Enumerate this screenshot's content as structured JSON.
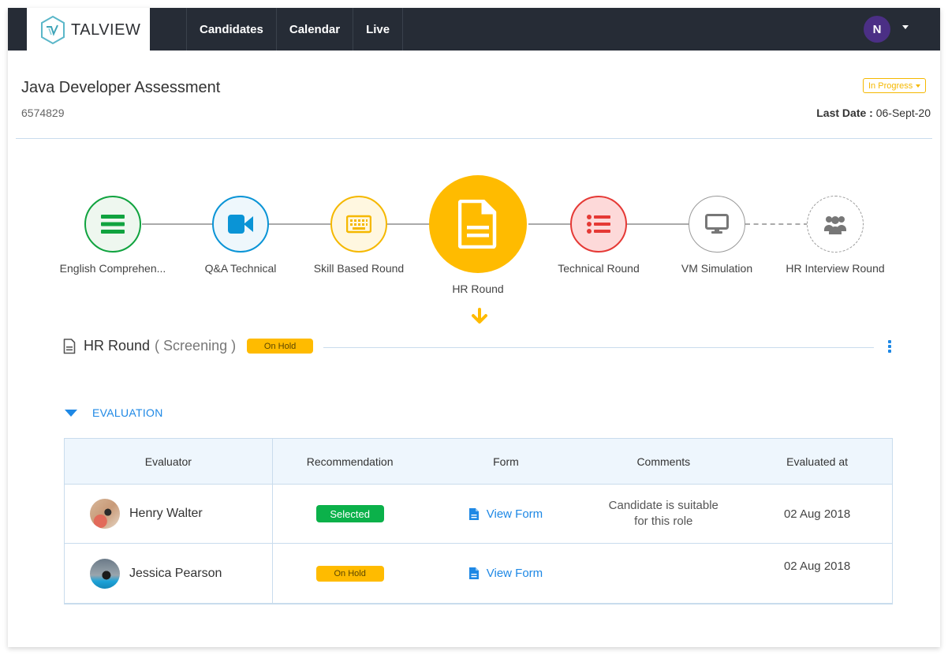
{
  "app": {
    "brand": "TALVIEW",
    "nav": [
      {
        "label": "Candidates"
      },
      {
        "label": "Calendar"
      },
      {
        "label": "Live"
      }
    ],
    "user_initial": "N",
    "colors": {
      "topbar": "#262c36",
      "accent": "#1e88e5",
      "warning": "#ffbb00",
      "success": "#0bb14a",
      "avatar": "#4b2f85"
    }
  },
  "header": {
    "title": "Java Developer Assessment",
    "id": "6574829",
    "status": "In Progress",
    "last_date_label": "Last Date :",
    "last_date_value": "06-Sept-20"
  },
  "pipeline": {
    "stages": [
      {
        "label": "English Comprehen...",
        "icon": "list-lines-icon",
        "state": "completed",
        "color": "#10a33f"
      },
      {
        "label": "Q&A Technical",
        "icon": "video-camera-icon",
        "state": "completed",
        "color": "#0a94d6"
      },
      {
        "label": "Skill Based Round",
        "icon": "keyboard-icon",
        "state": "completed",
        "color": "#f5b800"
      },
      {
        "label": "HR Round",
        "icon": "document-icon",
        "state": "current",
        "color": "#ffbb00"
      },
      {
        "label": "Technical Round",
        "icon": "bullet-list-icon",
        "state": "failed",
        "color": "#e53935"
      },
      {
        "label": "VM Simulation",
        "icon": "monitor-icon",
        "state": "pending",
        "color": "#888888"
      },
      {
        "label": "HR Interview Round",
        "icon": "group-icon",
        "state": "upcoming",
        "color": "#888888"
      }
    ]
  },
  "round": {
    "title": "HR Round",
    "subtitle": "( Screening )",
    "status": "On Hold"
  },
  "evaluation": {
    "section_label": "EVALUATION",
    "columns": [
      "Evaluator",
      "Recommendation",
      "Form",
      "Comments",
      "Evaluated at"
    ],
    "rows": [
      {
        "evaluator": "Henry Walter",
        "recommendation": "Selected",
        "form_link": "View Form",
        "comments_line1": "Candidate is suitable",
        "comments_line2": "for this role",
        "evaluated_at": "02 Aug 2018"
      },
      {
        "evaluator": "Jessica Pearson",
        "recommendation": "On Hold",
        "form_link": "View Form",
        "comments_line1": "",
        "comments_line2": "",
        "evaluated_at": "02 Aug 2018"
      }
    ]
  }
}
